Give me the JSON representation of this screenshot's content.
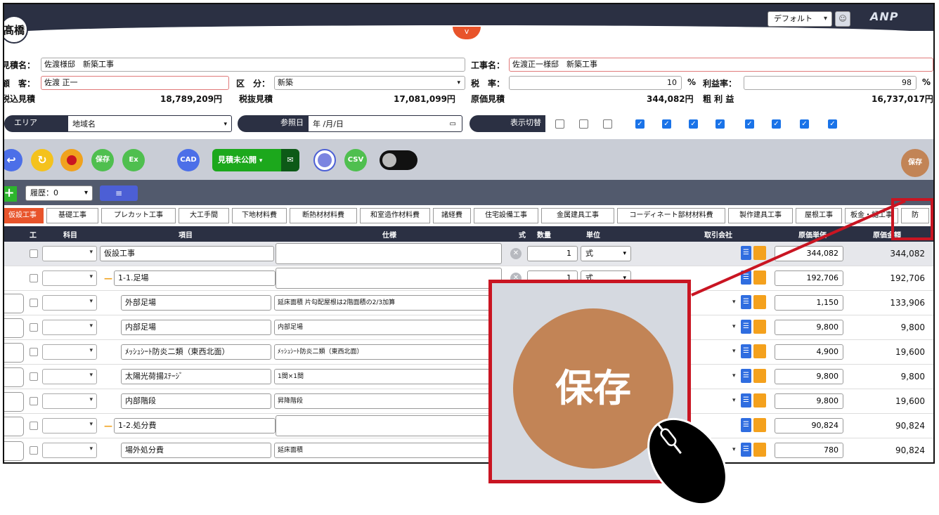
{
  "header": {
    "user_initial": "髙橋",
    "collapse": "v",
    "mode_select": "デフォルト",
    "logo": "ANP"
  },
  "form": {
    "estimate_name_label": "見積名：",
    "estimate_name": "佐渡様邸　新築工事",
    "project_name_label": "工事名：",
    "project_name": "佐渡正一様邸　新築工事",
    "customer_label": "顧　客：",
    "customer": "佐渡 正一",
    "category_label": "区　分：",
    "category": "新築",
    "tax_label": "税　率：",
    "tax": "10",
    "tax_unit": "%",
    "profit_label": "利益率：",
    "profit": "98",
    "profit_unit": "%"
  },
  "summary": {
    "incl_label": "税込見積",
    "incl_value": "18,789,209円",
    "excl_label": "税抜見積",
    "excl_value": "17,081,099円",
    "cost_label": "原価見積",
    "cost_value": "344,082円",
    "gross_label": "粗 利 益",
    "gross_value": "16,737,017円"
  },
  "filters": {
    "area_label": "エリア",
    "area_value": "地域名",
    "ref_date_label": "参照日",
    "ref_date_value": "年 /月/日",
    "display_label": "表示切替",
    "checkboxes": [
      false,
      false,
      false,
      true,
      true,
      true,
      true,
      true,
      true,
      true,
      true
    ]
  },
  "toolbar": {
    "save": "保存",
    "ex": "Ex",
    "cad": "CAD",
    "estimate_status": "見積未公開",
    "csv": "CSV"
  },
  "history": {
    "label": "履歴：0",
    "list_icon": "≡"
  },
  "tabs": [
    "仮設工事",
    "基礎工事",
    "プレカット工事",
    "大工手間",
    "下地材料費",
    "断熱材材料費",
    "和室造作材料費",
    "諸経費",
    "住宅設備工事",
    "金属建具工事",
    "コーディネート部材材料費",
    "製作建具工事",
    "屋根工事",
    "板金・樋工事",
    "防"
  ],
  "table_header": {
    "work": "工",
    "subject": "科目",
    "item": "項目",
    "spec": "仕様",
    "formula": "式",
    "qty": "数量",
    "unit": "単位",
    "vendor": "取引会社",
    "unit_cost": "原価単価",
    "cost_amount": "原価金額"
  },
  "rows": [
    {
      "name": "仮設工事",
      "spec": "",
      "qty": "1",
      "unit": "式",
      "price": "344,082",
      "amount": "344,082"
    },
    {
      "name": "1-1.足場",
      "spec": "",
      "qty": "1",
      "unit": "式",
      "price": "192,706",
      "amount": "192,706"
    },
    {
      "name": "外部足場",
      "spec": "延床面積 片勾配屋根は2階面積の2/3加算",
      "price": "1,150",
      "amount": "133,906"
    },
    {
      "name": "内部足場",
      "spec": "内部足場",
      "price": "9,800",
      "amount": "9,800"
    },
    {
      "name": "ﾒｯｼｭｼｰﾄ防炎二類（東西北面）",
      "spec": "ﾒｯｼｭｼｰﾄ防炎二類（東西北面）",
      "price": "4,900",
      "amount": "19,600"
    },
    {
      "name": "太陽光荷揚ｽﾃｰｼﾞ",
      "spec": "1間×1間",
      "price": "9,800",
      "amount": "9,800"
    },
    {
      "name": "内部階段",
      "spec": "昇降階段",
      "price": "9,800",
      "amount": "19,600"
    },
    {
      "name": "1-2.処分費",
      "spec": "",
      "price": "90,824",
      "amount": "90,824"
    },
    {
      "name": "場外処分費",
      "spec": "延床面積",
      "price": "780",
      "amount": "90,824"
    }
  ],
  "zoom": {
    "save_label": "保存"
  }
}
